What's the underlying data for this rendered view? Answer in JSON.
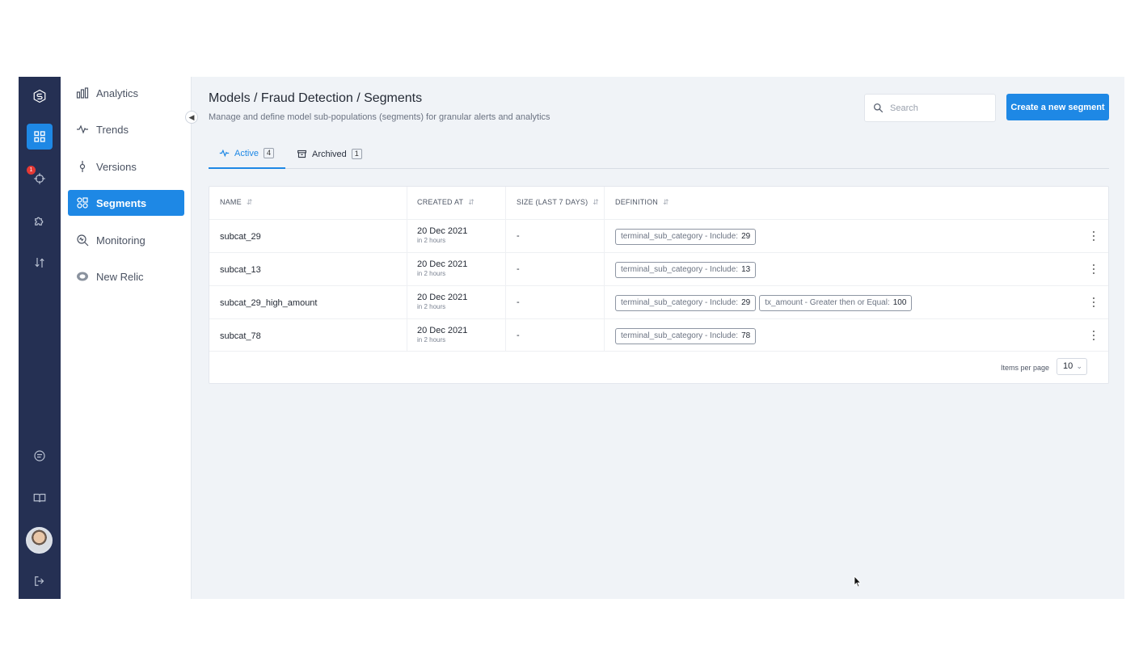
{
  "colors": {
    "accent": "#1e88e5",
    "rail": "#253053",
    "badge": "#e53935"
  },
  "rail": {
    "items": [
      {
        "name": "logo-icon"
      },
      {
        "name": "dashboard-icon",
        "active": true
      },
      {
        "name": "target-icon",
        "badge": "1"
      },
      {
        "name": "puzzle-icon"
      },
      {
        "name": "swap-icon"
      }
    ],
    "bottom": [
      {
        "name": "chat-icon"
      },
      {
        "name": "book-icon"
      },
      {
        "name": "avatar"
      },
      {
        "name": "logout-icon"
      }
    ]
  },
  "subnav": {
    "items": [
      {
        "label": "Analytics",
        "icon": "bar-chart-icon"
      },
      {
        "label": "Trends",
        "icon": "pulse-icon"
      },
      {
        "label": "Versions",
        "icon": "commit-icon"
      },
      {
        "label": "Segments",
        "icon": "segments-icon",
        "active": true
      },
      {
        "label": "Monitoring",
        "icon": "monitor-search-icon"
      },
      {
        "label": "New Relic",
        "icon": "new-relic-icon"
      }
    ]
  },
  "header": {
    "title": "Models / Fraud Detection / Segments",
    "subtitle": "Manage and define model sub-populations (segments) for granular alerts and analytics",
    "search_placeholder": "Search",
    "create_label": "Create a new segment"
  },
  "tabs": [
    {
      "label": "Active",
      "count": "4",
      "active": true
    },
    {
      "label": "Archived",
      "count": "1"
    }
  ],
  "table": {
    "columns": [
      "NAME",
      "CREATED AT",
      "SIZE (LAST 7 DAYS)",
      "DEFINITION"
    ],
    "rows": [
      {
        "name": "subcat_29",
        "date": "20 Dec 2021",
        "ago": "in 2 hours",
        "size": "-",
        "chips": [
          {
            "label": "terminal_sub_category - Include:",
            "value": "29"
          }
        ]
      },
      {
        "name": "subcat_13",
        "date": "20 Dec 2021",
        "ago": "in 2 hours",
        "size": "-",
        "chips": [
          {
            "label": "terminal_sub_category - Include:",
            "value": "13"
          }
        ]
      },
      {
        "name": "subcat_29_high_amount",
        "date": "20 Dec 2021",
        "ago": "in 2 hours",
        "size": "-",
        "chips": [
          {
            "label": "terminal_sub_category - Include:",
            "value": "29"
          },
          {
            "label": "tx_amount - Greater then or Equal:",
            "value": "100"
          }
        ]
      },
      {
        "name": "subcat_78",
        "date": "20 Dec 2021",
        "ago": "in 2 hours",
        "size": "-",
        "chips": [
          {
            "label": "terminal_sub_category - Include:",
            "value": "78"
          }
        ]
      }
    ]
  },
  "pager": {
    "label": "Items per page",
    "value": "10"
  }
}
